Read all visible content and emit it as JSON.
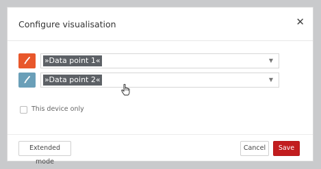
{
  "dialog": {
    "title": "Configure visualisation",
    "close_icon": "close-icon"
  },
  "data_points": [
    {
      "label": "»Data point 1«",
      "color": "#e8572b",
      "icon": "brush-icon"
    },
    {
      "label": "»Data point 2«",
      "color": "#6a9fb8",
      "icon": "brush-icon"
    }
  ],
  "options": {
    "device_only_label": "This device only",
    "device_only_checked": false
  },
  "footer": {
    "extended_mode_label": "Extended mode",
    "cancel_label": "Cancel",
    "save_label": "Save",
    "save_color": "#c21d1f"
  },
  "pointer": "hand-cursor-icon"
}
